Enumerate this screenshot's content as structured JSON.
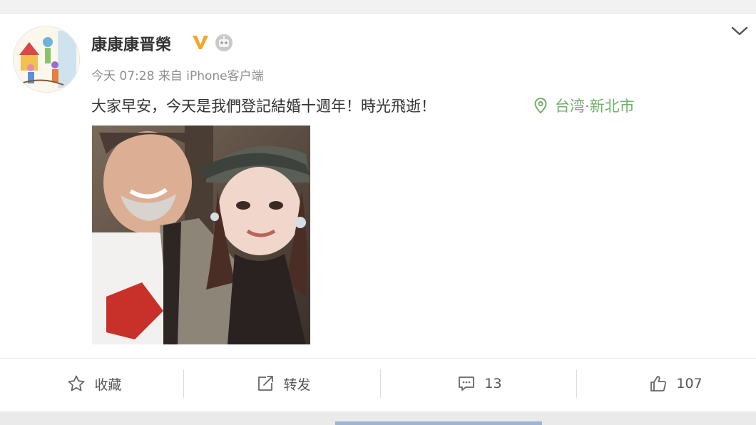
{
  "post": {
    "username": "康康康晋榮",
    "meta": {
      "time": "今天 07:28",
      "source": "来自 iPhone客户端"
    },
    "text": "大家早安，今天是我們登記結婚十週年！時光飛逝！",
    "location": "台湾·新北市"
  },
  "icons": {
    "verified": "verified-v-icon",
    "robot": "robot-badge-icon",
    "more": "chevron-down-icon",
    "location": "location-pin-icon",
    "favorite": "star-icon",
    "repost": "share-icon",
    "comment": "comment-icon",
    "like": "thumbs-up-icon"
  },
  "actions": {
    "favorite_label": "收藏",
    "repost_label": "转发",
    "comment_count": "13",
    "like_count": "107"
  },
  "colors": {
    "verified": "#f5a623",
    "location": "#72b06a",
    "text": "#333333",
    "meta": "#8f8f8f"
  }
}
